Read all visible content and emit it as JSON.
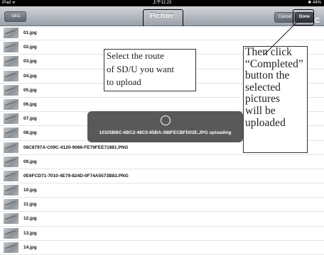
{
  "status_bar": {
    "device": "iPad ᯤ",
    "time": "上午11:23",
    "battery": "✱ 44%"
  },
  "nav": {
    "back_label": "sds1",
    "title": "Picture",
    "cancel_label": "Cancel",
    "done_label": "Done",
    "refresh_icon": "C"
  },
  "files": [
    "01.jpg",
    "02.jpg",
    "03.jpg",
    "04.jpg",
    "05.jpg",
    "06.jpg",
    "07.jpg",
    "08.jpg",
    "08C8797A-C09C-4120-9086-FE79FEE71981.PNG",
    "09.jpg",
    "0E6FCD71-7010-4E79-824D-0F74A5573B83.PNG",
    "10.jpg",
    "11.jpg",
    "12.jpg",
    "13.jpg",
    "14.jpg"
  ],
  "toast": {
    "text": "10325BBC-6BC2-48C0-85BA-388FECBFD03E.JPG uploading"
  },
  "callouts": {
    "left": [
      "Select the route",
      "of SD/U you want",
      "to upload"
    ],
    "right": [
      "Then click",
      "“Completed”",
      "button the",
      "selected",
      "pictures",
      "will be",
      "uploaded"
    ]
  }
}
